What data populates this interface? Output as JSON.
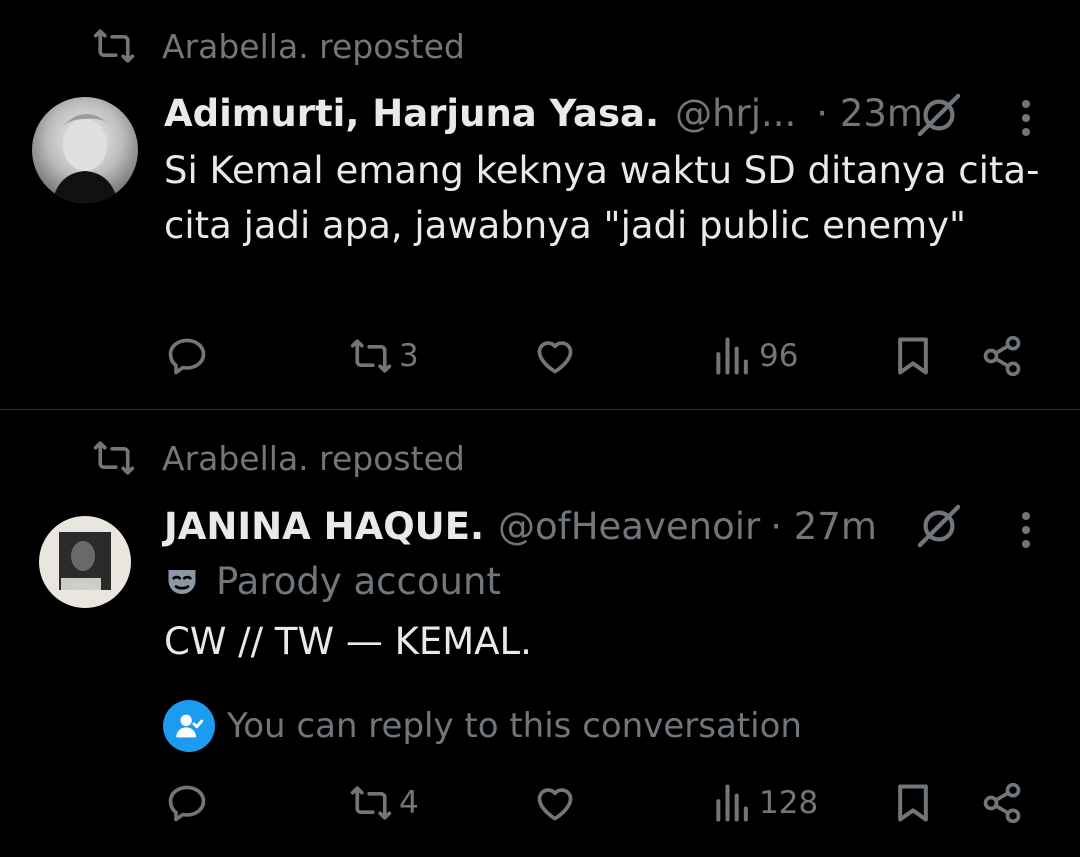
{
  "posts": [
    {
      "repost_label": "Arabella. reposted",
      "display_name": "Adimurti, Harjuna Yasa.",
      "handle": "@hrj...",
      "time": "· 23m",
      "text": "Si Kemal emang keknya waktu SD ditanya cita-cita jadi apa, jawabnya \"jadi public enemy\"",
      "retweet_count": "3",
      "view_count": "96",
      "icons": [
        "retweet-icon",
        "avatar",
        "mute-icon",
        "more-icon",
        "reply-icon",
        "retweet-icon",
        "like-icon",
        "views-icon",
        "bookmark-icon",
        "share-icon"
      ]
    },
    {
      "repost_label": "Arabella. reposted",
      "display_name": "JANINA HAQUE.",
      "handle": "@ofHeavenoir",
      "time": "· 27m",
      "parody_label": "Parody account",
      "text": "CW // TW — KEMAL.",
      "reply_notice": "You can reply to this conversation",
      "retweet_count": "4",
      "view_count": "128",
      "icons": [
        "retweet-icon",
        "avatar",
        "mute-icon",
        "more-icon",
        "mask-icon",
        "verified-user-icon",
        "reply-icon",
        "retweet-icon",
        "like-icon",
        "views-icon",
        "bookmark-icon",
        "share-icon"
      ]
    }
  ],
  "colors": {
    "background": "#000000",
    "text": "#e7e9ea",
    "secondary": "#71767b",
    "accent": "#1d9bf0",
    "divider": "#2f3336"
  }
}
